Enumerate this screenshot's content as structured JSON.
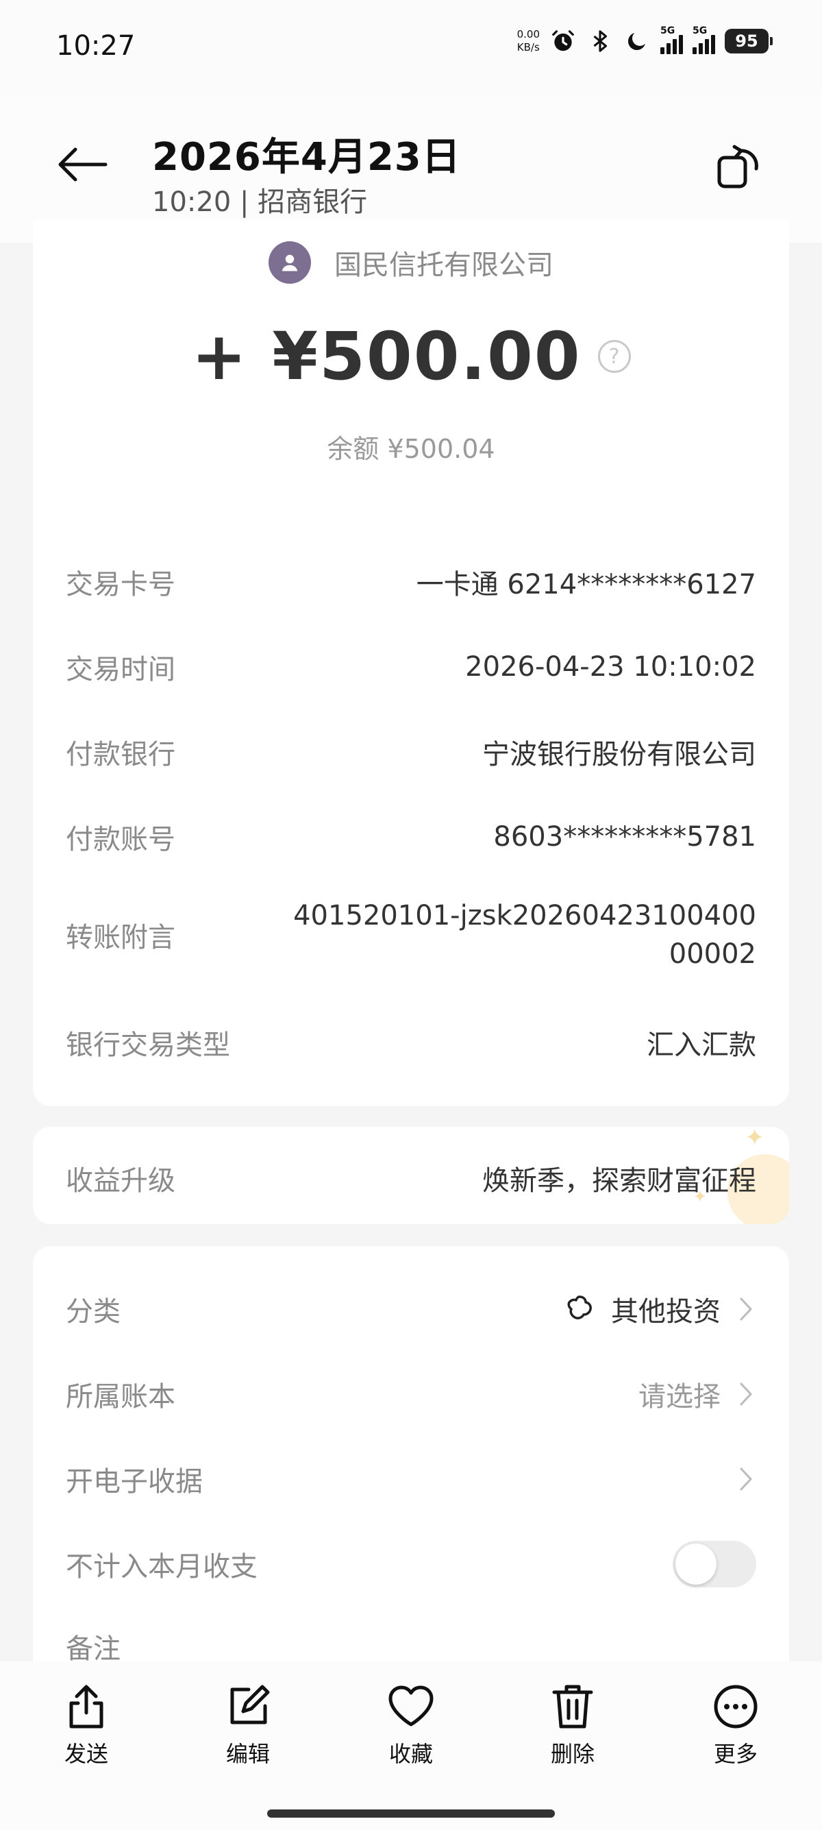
{
  "status_bar": {
    "time": "10:27",
    "net_speed_value": "0.00",
    "net_speed_unit": "KB/s",
    "signal1_tag": "5G",
    "signal2_tag": "5G",
    "battery": "95"
  },
  "header": {
    "title": "2026年4月23日",
    "subtitle": "10:20 | 招商银行"
  },
  "transaction": {
    "payer_name": "国民信托有限公司",
    "amount": "+ ¥500.00",
    "balance": "余额 ¥500.04"
  },
  "details": [
    {
      "label": "交易卡号",
      "value": "一卡通 6214********6127"
    },
    {
      "label": "交易时间",
      "value": "2026-04-23 10:10:02"
    },
    {
      "label": "付款银行",
      "value": "宁波银行股份有限公司"
    },
    {
      "label": "付款账号",
      "value": "8603*********5781"
    },
    {
      "label": "转账附言",
      "value": "401520101-jzsk2026042310040000002"
    },
    {
      "label": "银行交易类型",
      "value": "汇入汇款"
    }
  ],
  "promo": {
    "label": "收益升级",
    "value": "焕新季，探索财富征程"
  },
  "settings": {
    "category_label": "分类",
    "category_value": "其他投资",
    "ledger_label": "所属账本",
    "ledger_placeholder": "请选择",
    "receipt_label": "开电子收据",
    "exclude_label": "不计入本月收支",
    "exclude_enabled": false,
    "note_label": "备注"
  },
  "actions": {
    "send": "发送",
    "edit": "编辑",
    "favorite": "收藏",
    "delete": "删除",
    "more": "更多"
  }
}
